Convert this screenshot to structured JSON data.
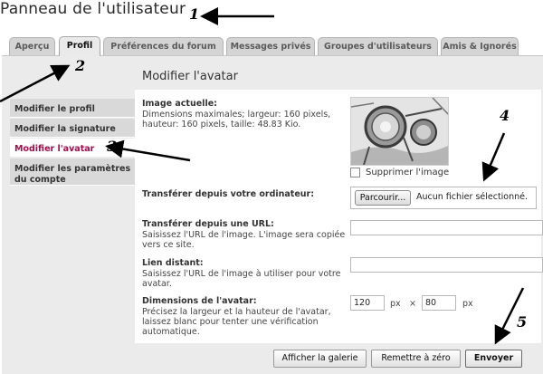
{
  "page": {
    "title": "Panneau de l'utilisateur"
  },
  "tabs": [
    {
      "label": "Aperçu",
      "active": false
    },
    {
      "label": "Profil",
      "active": true
    },
    {
      "label": "Préférences du forum",
      "active": false
    },
    {
      "label": "Messages privés",
      "active": false
    },
    {
      "label": "Groupes d'utilisateurs",
      "active": false
    },
    {
      "label": "Amis & Ignorés",
      "active": false
    }
  ],
  "sidebar": {
    "items": [
      {
        "label": "Modifier le profil",
        "active": false
      },
      {
        "label": "Modifier la signature",
        "active": false
      },
      {
        "label": "Modifier l'avatar",
        "active": true
      },
      {
        "label": "Modifier les paramètres du compte",
        "active": false
      }
    ]
  },
  "main": {
    "section_title": "Modifier l'avatar",
    "current_image": {
      "label": "Image actuelle:",
      "description": "Dimensions maximales; largeur: 160 pixels, hauteur: 160 pixels, taille: 48.83 Kio.",
      "delete_label": "Supprimer l'image",
      "delete_checked": false
    },
    "upload": {
      "label": "Transférer depuis votre ordinateur:",
      "browse_label": "Parcourir...",
      "status": "Aucun fichier sélectionné."
    },
    "url_upload": {
      "label": "Transférer depuis une URL:",
      "description": "Saisissez l'URL de l'image. L'image sera copiée vers ce site.",
      "value": ""
    },
    "remote_link": {
      "label": "Lien distant:",
      "description": "Saisissez l'URL de l'image à utiliser pour votre avatar.",
      "value": ""
    },
    "dimensions": {
      "label": "Dimensions de l'avatar:",
      "description": "Précisez la largeur et la hauteur de l'avatar, laissez blanc pour tenter une vérification automatique.",
      "width": "120",
      "height": "80",
      "unit": "px",
      "separator": "×"
    }
  },
  "buttons": {
    "gallery": "Afficher la galerie",
    "reset": "Remettre à zéro",
    "submit": "Envoyer"
  },
  "annotations": [
    "1",
    "2",
    "3",
    "4",
    "5"
  ],
  "icons": {
    "avatar": "headlamp-photo-image",
    "arrows": "annotation-arrow"
  }
}
